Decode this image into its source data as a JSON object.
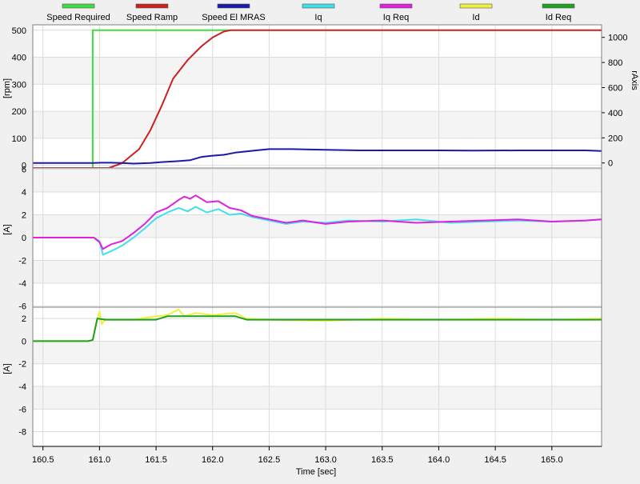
{
  "legend": [
    {
      "label": "Speed Required",
      "color": "#40dd40"
    },
    {
      "label": "Speed Ramp",
      "color": "#cc2020"
    },
    {
      "label": "Speed El MRAS",
      "color": "#1a1aaa"
    },
    {
      "label": "Iq",
      "color": "#40e0e8"
    },
    {
      "label": "Iq Req",
      "color": "#e020e0"
    },
    {
      "label": "Id",
      "color": "#f0f040"
    },
    {
      "label": "Id Req",
      "color": "#20a020"
    }
  ],
  "xaxis": {
    "label": "Time [sec]",
    "min": 160.41,
    "max": 165.44,
    "ticks": [
      160.5,
      161.0,
      161.5,
      162.0,
      162.5,
      163.0,
      163.5,
      164.0,
      164.5,
      165.0
    ],
    "tick_labels": [
      "160.5",
      "161.0",
      "161.5",
      "162.0",
      "162.5",
      "163.0",
      "163.5",
      "164.0",
      "164.5",
      "165.0"
    ]
  },
  "chart_data": [
    {
      "type": "line",
      "ylabel": "[rpm]",
      "y2label": "rAxis",
      "ylim": [
        -10,
        520
      ],
      "yticks": [
        0,
        100,
        200,
        300,
        400,
        500
      ],
      "y2lim": [
        -40,
        1100
      ],
      "y2ticks": [
        0,
        200,
        400,
        600,
        800,
        1000
      ],
      "grid": true,
      "series": [
        {
          "name": "Speed Required",
          "color": "#40dd40",
          "axis": "left",
          "points": [
            [
              160.41,
              -10
            ],
            [
              160.94,
              -10
            ],
            [
              160.94,
              500
            ],
            [
              162.16,
              500
            ]
          ]
        },
        {
          "name": "Speed Ramp",
          "color": "#cc2020",
          "axis": "left",
          "points": [
            [
              160.41,
              -10
            ],
            [
              161.08,
              -10
            ],
            [
              161.2,
              8
            ],
            [
              161.35,
              60
            ],
            [
              161.45,
              130
            ],
            [
              161.55,
              220
            ],
            [
              161.65,
              320
            ],
            [
              161.78,
              390
            ],
            [
              161.9,
              440
            ],
            [
              162.0,
              473
            ],
            [
              162.1,
              495
            ],
            [
              162.16,
              500
            ],
            [
              165.44,
              500
            ]
          ]
        },
        {
          "name": "Speed El MRAS",
          "color": "#1a1aaa",
          "axis": "right",
          "points": [
            [
              160.41,
              0
            ],
            [
              160.94,
              0
            ],
            [
              161.02,
              2
            ],
            [
              161.1,
              2
            ],
            [
              161.2,
              0
            ],
            [
              161.3,
              -5
            ],
            [
              161.45,
              0
            ],
            [
              161.55,
              7
            ],
            [
              161.7,
              15
            ],
            [
              161.8,
              22
            ],
            [
              161.9,
              48
            ],
            [
              162.0,
              58
            ],
            [
              162.1,
              65
            ],
            [
              162.2,
              82
            ],
            [
              162.35,
              97
            ],
            [
              162.5,
              110
            ],
            [
              162.7,
              110
            ],
            [
              163.0,
              105
            ],
            [
              163.3,
              100
            ],
            [
              163.6,
              100
            ],
            [
              164.0,
              100
            ],
            [
              164.3,
              98
            ],
            [
              164.7,
              100
            ],
            [
              165.0,
              100
            ],
            [
              165.3,
              100
            ],
            [
              165.44,
              95
            ]
          ]
        }
      ]
    },
    {
      "type": "line",
      "ylabel": "[A]",
      "ylim": [
        -6.1,
        6.1
      ],
      "yticks": [
        -6,
        -4,
        -2,
        0,
        2,
        4,
        6
      ],
      "grid": true,
      "series": [
        {
          "name": "Iq",
          "color": "#40e0e8",
          "points": [
            [
              160.41,
              0
            ],
            [
              160.88,
              0
            ],
            [
              160.95,
              0
            ],
            [
              161.0,
              -0.3
            ],
            [
              161.03,
              -1.5
            ],
            [
              161.1,
              -1.2
            ],
            [
              161.2,
              -0.7
            ],
            [
              161.3,
              0
            ],
            [
              161.4,
              0.8
            ],
            [
              161.5,
              1.7
            ],
            [
              161.6,
              2.2
            ],
            [
              161.7,
              2.6
            ],
            [
              161.78,
              2.3
            ],
            [
              161.85,
              2.7
            ],
            [
              161.95,
              2.2
            ],
            [
              162.05,
              2.5
            ],
            [
              162.15,
              2.0
            ],
            [
              162.25,
              2.1
            ],
            [
              162.35,
              1.8
            ],
            [
              162.5,
              1.5
            ],
            [
              162.65,
              1.2
            ],
            [
              162.8,
              1.4
            ],
            [
              163.0,
              1.3
            ],
            [
              163.2,
              1.5
            ],
            [
              163.5,
              1.4
            ],
            [
              163.8,
              1.6
            ],
            [
              164.1,
              1.3
            ],
            [
              164.4,
              1.4
            ],
            [
              164.7,
              1.5
            ],
            [
              165.0,
              1.4
            ],
            [
              165.3,
              1.5
            ],
            [
              165.44,
              1.6
            ]
          ]
        },
        {
          "name": "Iq Req",
          "color": "#e020e0",
          "points": [
            [
              160.41,
              0
            ],
            [
              160.88,
              0
            ],
            [
              160.95,
              0
            ],
            [
              161.0,
              -0.4
            ],
            [
              161.03,
              -1.0
            ],
            [
              161.1,
              -0.6
            ],
            [
              161.2,
              -0.3
            ],
            [
              161.3,
              0.4
            ],
            [
              161.4,
              1.2
            ],
            [
              161.5,
              2.2
            ],
            [
              161.6,
              2.6
            ],
            [
              161.7,
              3.3
            ],
            [
              161.75,
              3.6
            ],
            [
              161.8,
              3.4
            ],
            [
              161.85,
              3.7
            ],
            [
              161.95,
              3.1
            ],
            [
              162.05,
              3.2
            ],
            [
              162.15,
              2.6
            ],
            [
              162.25,
              2.4
            ],
            [
              162.35,
              1.9
            ],
            [
              162.5,
              1.6
            ],
            [
              162.65,
              1.3
            ],
            [
              162.8,
              1.5
            ],
            [
              163.0,
              1.2
            ],
            [
              163.2,
              1.4
            ],
            [
              163.5,
              1.5
            ],
            [
              163.8,
              1.3
            ],
            [
              164.1,
              1.4
            ],
            [
              164.4,
              1.5
            ],
            [
              164.7,
              1.6
            ],
            [
              165.0,
              1.4
            ],
            [
              165.3,
              1.5
            ],
            [
              165.44,
              1.6
            ]
          ]
        }
      ]
    },
    {
      "type": "line",
      "ylabel": "[A]",
      "ylim": [
        -9.3,
        3.0
      ],
      "yticks": [
        -8,
        -6,
        -4,
        -2,
        0,
        2
      ],
      "grid": true,
      "series": [
        {
          "name": "Id",
          "color": "#f0f040",
          "points": [
            [
              160.41,
              0
            ],
            [
              160.9,
              0
            ],
            [
              160.94,
              0.1
            ],
            [
              160.98,
              1.9
            ],
            [
              161.0,
              2.6
            ],
            [
              161.02,
              1.5
            ],
            [
              161.05,
              1.9
            ],
            [
              161.1,
              1.9
            ],
            [
              161.3,
              1.9
            ],
            [
              161.5,
              2.2
            ],
            [
              161.6,
              2.3
            ],
            [
              161.7,
              2.8
            ],
            [
              161.75,
              2.2
            ],
            [
              161.85,
              2.5
            ],
            [
              162.0,
              2.3
            ],
            [
              162.2,
              2.5
            ],
            [
              162.3,
              2.0
            ],
            [
              162.5,
              1.9
            ],
            [
              163.0,
              1.8
            ],
            [
              163.5,
              2.0
            ],
            [
              164.0,
              1.9
            ],
            [
              164.5,
              2.0
            ],
            [
              165.0,
              1.9
            ],
            [
              165.44,
              2.0
            ]
          ]
        },
        {
          "name": "Id Req",
          "color": "#20a020",
          "points": [
            [
              160.41,
              0
            ],
            [
              160.9,
              0
            ],
            [
              160.94,
              0.1
            ],
            [
              160.98,
              2.0
            ],
            [
              161.05,
              1.9
            ],
            [
              161.5,
              1.9
            ],
            [
              161.6,
              2.2
            ],
            [
              161.9,
              2.2
            ],
            [
              162.2,
              2.2
            ],
            [
              162.3,
              1.9
            ],
            [
              165.44,
              1.9
            ]
          ]
        }
      ]
    }
  ]
}
